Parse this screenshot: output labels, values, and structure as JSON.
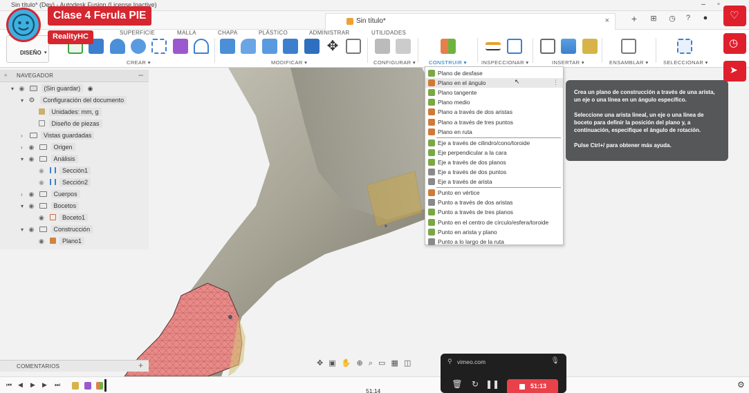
{
  "window": {
    "title": "Sin título* (Dev) - Autodesk Fusion (License Inactive)",
    "tab_title": "Sin título*"
  },
  "overlay": {
    "course_title": "Clase 4 Ferula PIE",
    "channel": "RealityHC"
  },
  "toolbar": {
    "workspace": "DISEÑO",
    "tabs": [
      "SUPERFICIE",
      "MALLA",
      "CHAPA",
      "PLÁSTICO",
      "ADMINISTRAR",
      "UTILIDADES"
    ],
    "groups": [
      "CREAR",
      "MODIFICAR",
      "CONFIGURAR",
      "CONSTRUIR",
      "INSPECCIONAR",
      "INSERTAR",
      "ENSAMBLAR",
      "SELECCIONAR"
    ],
    "active_group": "CONSTRUIR"
  },
  "navigator": {
    "title": "NAVEGADOR",
    "items": [
      {
        "label": "(Sin guardar)"
      },
      {
        "label": "Configuración del documento"
      },
      {
        "label": "Unidades: mm, g"
      },
      {
        "label": "Diseño de piezas"
      },
      {
        "label": "Vistas guardadas"
      },
      {
        "label": "Origen"
      },
      {
        "label": "Análisis"
      },
      {
        "label": "Sección1"
      },
      {
        "label": "Sección2"
      },
      {
        "label": "Cuerpos"
      },
      {
        "label": "Bocetos"
      },
      {
        "label": "Boceto1"
      },
      {
        "label": "Construcción"
      },
      {
        "label": "Plano1"
      }
    ]
  },
  "construct_menu": {
    "items": [
      {
        "label": "Plano de desfase",
        "color": "#7aa845"
      },
      {
        "label": "Plano en el ángulo",
        "color": "#d07a3a"
      },
      {
        "label": "Plano tangente",
        "color": "#7aa845"
      },
      {
        "label": "Plano medio",
        "color": "#7aa845"
      },
      {
        "label": "Plano a través de dos aristas",
        "color": "#d07a3a"
      },
      {
        "label": "Plano a través de tres puntos",
        "color": "#d07a3a"
      },
      {
        "label": "Plano en ruta",
        "color": "#d07a3a"
      },
      {
        "label": "Eje a través de cilindro/cono/toroide",
        "color": "#7aa845"
      },
      {
        "label": "Eje perpendicular a la cara",
        "color": "#7aa845"
      },
      {
        "label": "Eje a través de dos planos",
        "color": "#7aa845"
      },
      {
        "label": "Eje a través de dos puntos",
        "color": "#8a8a8a"
      },
      {
        "label": "Eje a través de arista",
        "color": "#8a8a8a"
      },
      {
        "label": "Punto en vértice",
        "color": "#d07a3a"
      },
      {
        "label": "Punto a través de dos aristas",
        "color": "#8a8a8a"
      },
      {
        "label": "Punto a través de tres planos",
        "color": "#7aa845"
      },
      {
        "label": "Punto en el centro de círculo/esfera/toroide",
        "color": "#7aa845"
      },
      {
        "label": "Punto en arista y plano",
        "color": "#7aa845"
      },
      {
        "label": "Punto a lo largo de la ruta",
        "color": "#8a8a8a"
      }
    ]
  },
  "tooltip": {
    "p1": "Crea un plano de construcción a través de una arista, un eje o una línea en un ángulo específico.",
    "p2": "Seleccione una arista lineal, un eje o una línea de boceto para definir la posición del plano y, a continuación, especifique el ángulo de rotación.",
    "p3": "Pulse Ctrl+/ para obtener más ayuda."
  },
  "comments": {
    "title": "COMENTARIOS"
  },
  "timeline": {
    "timecode": "51:14"
  },
  "vimeo": {
    "url": "vimeo.com",
    "rec_time": "51:13"
  },
  "colors": {
    "accent": "#0a6fc2",
    "red": "#d6262f",
    "model": "#c9c7bb",
    "mesh": "#e88b88"
  }
}
